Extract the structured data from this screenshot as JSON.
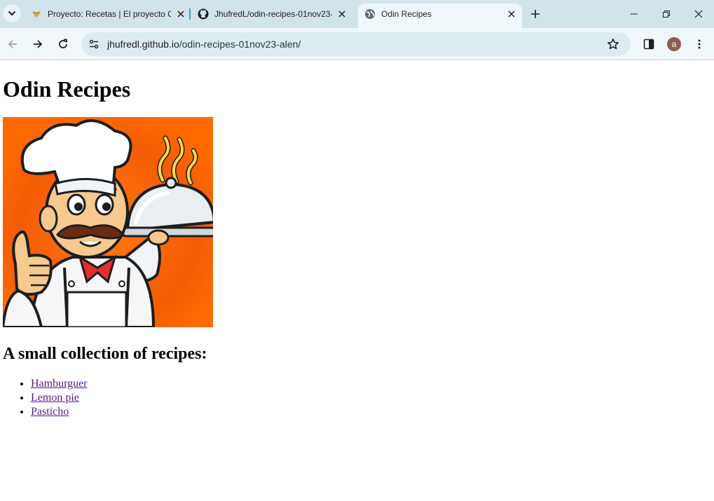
{
  "browser": {
    "tabs": [
      {
        "title": "Proyecto: Recetas | El proyecto O",
        "favicon": "odin-icon"
      },
      {
        "title": "JhufredL/odin-recipes-01nov23-",
        "favicon": "github-icon"
      },
      {
        "title": "Odin Recipes",
        "favicon": "globe-icon",
        "active": true
      }
    ],
    "address_bar": {
      "host": "jhufredl.github.io",
      "path": "/odin-recipes-01nov23-alen/"
    },
    "profile_initial": "a",
    "accent_color": "#d3e3ea"
  },
  "page": {
    "heading": "Odin Recipes",
    "image": {
      "subject": "cartoon chef holding a serving cloche and giving a thumbs up"
    },
    "subheading": "A small collection of recipes:",
    "recipes": [
      {
        "label": "Hamburguer"
      },
      {
        "label": "Lemon pie"
      },
      {
        "label": "Pasticho"
      }
    ],
    "link_color": "#551a8b"
  }
}
